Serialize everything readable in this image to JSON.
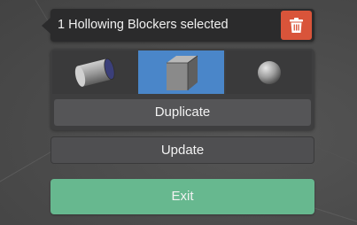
{
  "header": {
    "title": "1 Hollowing Blockers selected",
    "delete_icon": "trash-icon",
    "delete_color": "#d9543a"
  },
  "shapes": [
    {
      "icon": "cylinder-icon",
      "selected": false
    },
    {
      "icon": "cube-icon",
      "selected": true
    },
    {
      "icon": "sphere-icon",
      "selected": false
    }
  ],
  "actions": {
    "duplicate_label": "Duplicate",
    "update_label": "Update",
    "exit_label": "Exit"
  },
  "colors": {
    "selected": "#4a86c9",
    "exit": "#67b88f",
    "panel": "#2b2b2c"
  }
}
